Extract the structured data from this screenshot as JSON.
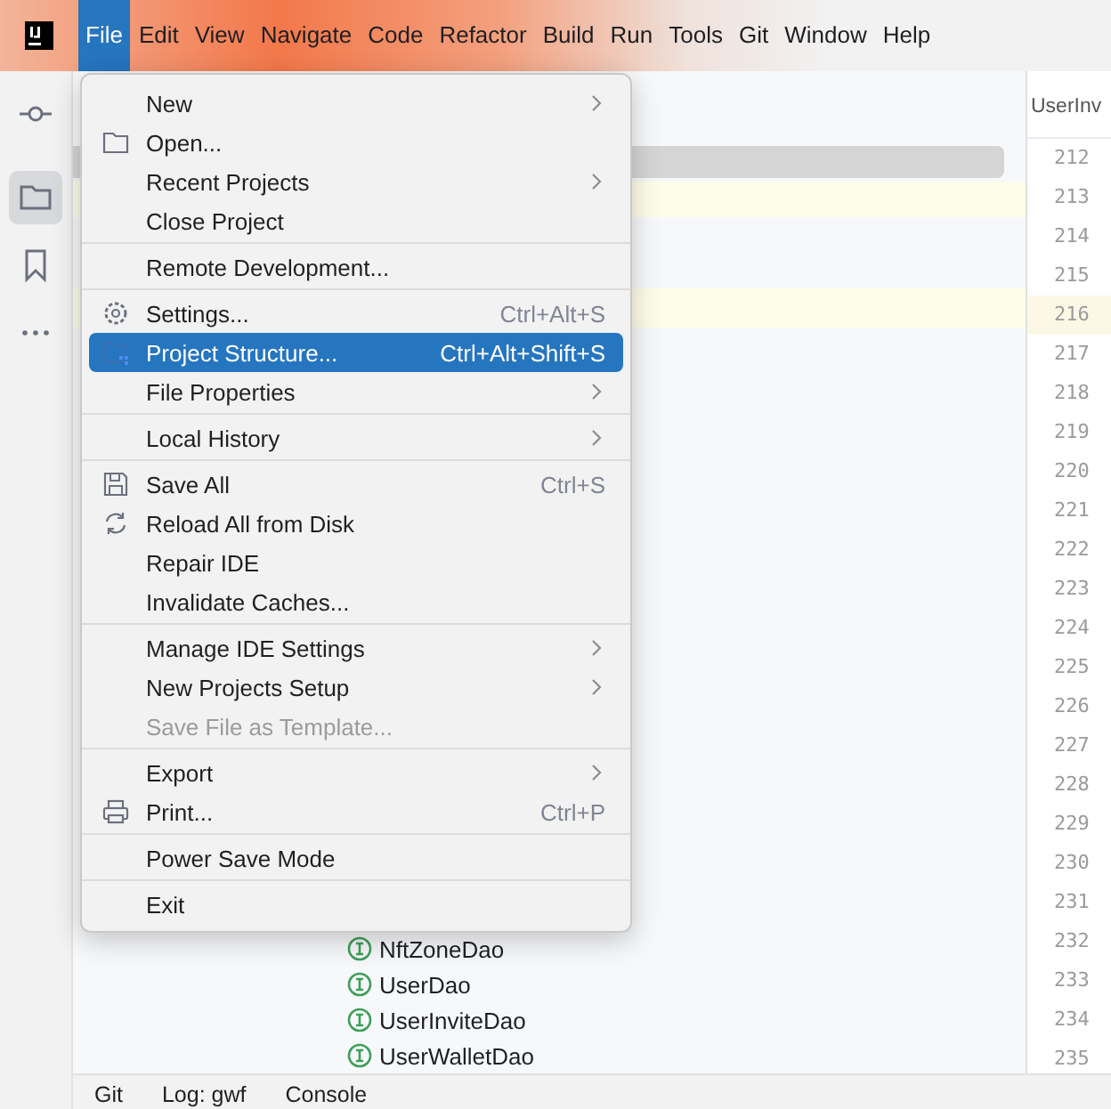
{
  "menu_bar": [
    {
      "label": "File",
      "selected": true
    },
    {
      "label": "Edit",
      "selected": false
    },
    {
      "label": "View",
      "selected": false
    },
    {
      "label": "Navigate",
      "selected": false
    },
    {
      "label": "Code",
      "selected": false
    },
    {
      "label": "Refactor",
      "selected": false
    },
    {
      "label": "Build",
      "selected": false
    },
    {
      "label": "Run",
      "selected": false
    },
    {
      "label": "Tools",
      "selected": false
    },
    {
      "label": "Git",
      "selected": false
    },
    {
      "label": "Window",
      "selected": false
    },
    {
      "label": "Help",
      "selected": false
    }
  ],
  "left_toolbar": [
    {
      "kind": "commit",
      "selected": false
    },
    {
      "kind": "folder",
      "selected": true
    },
    {
      "kind": "bookmark",
      "selected": false
    },
    {
      "kind": "more",
      "selected": false
    }
  ],
  "file_menu": [
    [
      {
        "label": "New",
        "submenu": true,
        "selected": false,
        "disabled": false
      },
      {
        "label": "Open...",
        "kind": "folder",
        "selected": false,
        "disabled": false
      },
      {
        "label": "Recent Projects",
        "submenu": true,
        "selected": false,
        "disabled": false
      },
      {
        "label": "Close Project",
        "selected": false,
        "disabled": false
      }
    ],
    [
      {
        "label": "Remote Development...",
        "selected": false,
        "disabled": false
      }
    ],
    [
      {
        "label": "Settings...",
        "kind": "gear",
        "shortcut": "Ctrl+Alt+S",
        "selected": false,
        "disabled": false
      },
      {
        "label": "Project Structure...",
        "kind": "structure",
        "shortcut": "Ctrl+Alt+Shift+S",
        "selected": true,
        "disabled": false
      },
      {
        "label": "File Properties",
        "submenu": true,
        "selected": false,
        "disabled": false
      }
    ],
    [
      {
        "label": "Local History",
        "submenu": true,
        "selected": false,
        "disabled": false
      }
    ],
    [
      {
        "label": "Save All",
        "kind": "save",
        "shortcut": "Ctrl+S",
        "selected": false,
        "disabled": false
      },
      {
        "label": "Reload All from Disk",
        "kind": "reload",
        "selected": false,
        "disabled": false
      },
      {
        "label": "Repair IDE",
        "selected": false,
        "disabled": false
      },
      {
        "label": "Invalidate Caches...",
        "selected": false,
        "disabled": false
      }
    ],
    [
      {
        "label": "Manage IDE Settings",
        "submenu": true,
        "selected": false,
        "disabled": false
      },
      {
        "label": "New Projects Setup",
        "submenu": true,
        "selected": false,
        "disabled": false
      },
      {
        "label": "Save File as Template...",
        "selected": false,
        "disabled": true
      }
    ],
    [
      {
        "label": "Export",
        "submenu": true,
        "selected": false,
        "disabled": false
      },
      {
        "label": "Print...",
        "kind": "print",
        "shortcut": "Ctrl+P",
        "selected": false,
        "disabled": false
      }
    ],
    [
      {
        "label": "Power Save Mode",
        "selected": false,
        "disabled": false
      }
    ],
    [
      {
        "label": "Exit",
        "selected": false,
        "disabled": false
      }
    ]
  ],
  "project_tree": [
    "NftZoneDao",
    "UserDao",
    "UserInviteDao",
    "UserWalletDao"
  ],
  "editor": {
    "tab": "UserInv",
    "lines": [
      {
        "number": "212",
        "current": false
      },
      {
        "number": "213",
        "current": false
      },
      {
        "number": "214",
        "current": false
      },
      {
        "number": "215",
        "current": false
      },
      {
        "number": "216",
        "current": true
      },
      {
        "number": "217",
        "current": false
      },
      {
        "number": "218",
        "current": false
      },
      {
        "number": "219",
        "current": false
      },
      {
        "number": "220",
        "current": false
      },
      {
        "number": "221",
        "current": false
      },
      {
        "number": "222",
        "current": false
      },
      {
        "number": "223",
        "current": false
      },
      {
        "number": "224",
        "current": false
      },
      {
        "number": "225",
        "current": false
      },
      {
        "number": "226",
        "current": false
      },
      {
        "number": "227",
        "current": false
      },
      {
        "number": "228",
        "current": false
      },
      {
        "number": "229",
        "current": false
      },
      {
        "number": "230",
        "current": false
      },
      {
        "number": "231",
        "current": false
      },
      {
        "number": "232",
        "current": false
      },
      {
        "number": "233",
        "current": false
      },
      {
        "number": "234",
        "current": false
      },
      {
        "number": "235",
        "current": false
      }
    ]
  },
  "bottom_tabs": [
    "Git",
    "Log: gwf",
    "Console"
  ]
}
